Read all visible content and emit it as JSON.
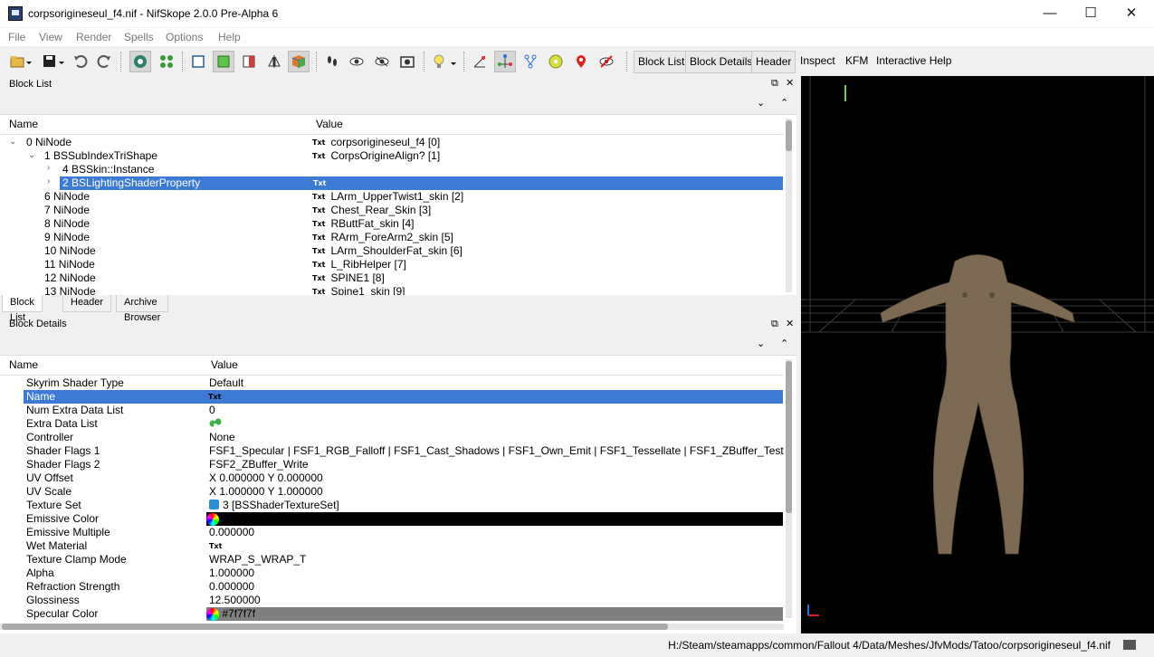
{
  "window": {
    "title": "corpsorigineseul_f4.nif - NifSkope 2.0.0 Pre-Alpha 6",
    "minimize": "—",
    "maximize": "☐",
    "close": "✕"
  },
  "menu": [
    "File",
    "View",
    "Render",
    "Spells",
    "Options",
    "Help"
  ],
  "toolbar": {
    "tabs": [
      "Block List",
      "Block Details",
      "Header"
    ],
    "links": [
      "Inspect",
      "KFM",
      "Interactive Help"
    ]
  },
  "block_list": {
    "title": "Block List",
    "col_name": "Name",
    "col_value": "Value",
    "rows": [
      {
        "name": "0 NiNode",
        "value": "corpsorigineseul_f4 [0]",
        "txt": "Txt"
      },
      {
        "name": "1 BSSubIndexTriShape",
        "value": "CorpsOrigineAlign? [1]",
        "txt": "Txt"
      },
      {
        "name": "4 BSSkin::Instance",
        "value": "",
        "txt": ""
      },
      {
        "name": "2 BSLightingShaderProperty",
        "value": "",
        "txt": "Txt"
      },
      {
        "name": "6 NiNode",
        "value": "LArm_UpperTwist1_skin [2]",
        "txt": "Txt"
      },
      {
        "name": "7 NiNode",
        "value": "Chest_Rear_Skin [3]",
        "txt": "Txt"
      },
      {
        "name": "8 NiNode",
        "value": "RButtFat_skin [4]",
        "txt": "Txt"
      },
      {
        "name": "9 NiNode",
        "value": "RArm_ForeArm2_skin [5]",
        "txt": "Txt"
      },
      {
        "name": "10 NiNode",
        "value": "LArm_ShoulderFat_skin [6]",
        "txt": "Txt"
      },
      {
        "name": "11 NiNode",
        "value": "L_RibHelper [7]",
        "txt": "Txt"
      },
      {
        "name": "12 NiNode",
        "value": "SPINE1 [8]",
        "txt": "Txt"
      },
      {
        "name": "13 NiNode",
        "value": "Spine1_skin [9]",
        "txt": "Txt"
      }
    ]
  },
  "bottom_tabs": [
    "Block List",
    "Header",
    "Archive Browser"
  ],
  "block_details": {
    "title": "Block Details",
    "col_name": "Name",
    "col_value": "Value",
    "rows": [
      {
        "name": "Skyrim Shader Type",
        "value": "Default"
      },
      {
        "name": "Name",
        "value": "Txt"
      },
      {
        "name": "Num Extra Data List",
        "value": "0"
      },
      {
        "name": "Extra Data List",
        "value": ""
      },
      {
        "name": "Controller",
        "value": "None"
      },
      {
        "name": "Shader Flags 1",
        "value": "FSF1_Specular | FSF1_RGB_Falloff | FSF1_Cast_Shadows | FSF1_Own_Emit | FSF1_Tessellate | FSF1_ZBuffer_Test"
      },
      {
        "name": "Shader Flags 2",
        "value": "FSF2_ZBuffer_Write"
      },
      {
        "name": "UV Offset",
        "value": "X 0.000000 Y 0.000000"
      },
      {
        "name": "UV Scale",
        "value": "X 1.000000 Y 1.000000"
      },
      {
        "name": "Texture Set",
        "value": "3 [BSShaderTextureSet]"
      },
      {
        "name": "Emissive Color",
        "value": ""
      },
      {
        "name": "Emissive Multiple",
        "value": "0.000000"
      },
      {
        "name": "Wet Material",
        "value": "Txt"
      },
      {
        "name": "Texture Clamp Mode",
        "value": "WRAP_S_WRAP_T"
      },
      {
        "name": "Alpha",
        "value": "1.000000"
      },
      {
        "name": "Refraction Strength",
        "value": "0.000000"
      },
      {
        "name": "Glossiness",
        "value": "12.500000"
      },
      {
        "name": "Specular Color",
        "value": "#7f7f7f"
      }
    ]
  },
  "status_path": "H:/Steam/steamapps/common/Fallout 4/Data/Meshes/JfvMods/Tatoo/corpsorigineseul_f4.nif",
  "colors": {
    "selection": "#3d7ad6",
    "specular_swatch": "#7f7f7f",
    "emissive_swatch": "#000000",
    "body_tone": "#7d6a55"
  }
}
